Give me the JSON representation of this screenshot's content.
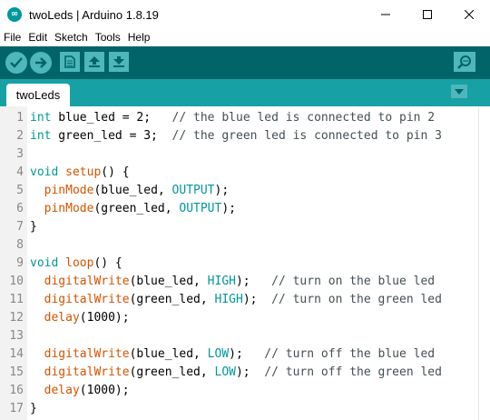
{
  "window": {
    "title": "twoLeds | Arduino 1.8.19",
    "logo_glyph": "∞"
  },
  "menu": [
    "File",
    "Edit",
    "Sketch",
    "Tools",
    "Help"
  ],
  "toolbar": {
    "buttons": [
      "verify-icon",
      "upload-icon",
      "new-icon",
      "open-icon",
      "save-icon",
      "serial-monitor-icon"
    ]
  },
  "tabs": [
    {
      "label": "twoLeds"
    }
  ],
  "editor": {
    "line_numbers": [
      "1",
      "2",
      "3",
      "4",
      "5",
      "6",
      "7",
      "8",
      "9",
      "10",
      "11",
      "12",
      "13",
      "14",
      "15",
      "16",
      "17"
    ],
    "lines": [
      [
        [
          "kw",
          "int"
        ],
        [
          "pl",
          " blue_led = 2;   "
        ],
        [
          "cm",
          "// the blue led is connected to pin 2"
        ]
      ],
      [
        [
          "kw",
          "int"
        ],
        [
          "pl",
          " green_led = 3;  "
        ],
        [
          "cm",
          "// the green led is connected to pin 3"
        ]
      ],
      [],
      [
        [
          "kw",
          "void"
        ],
        [
          "pl",
          " "
        ],
        [
          "fn",
          "setup"
        ],
        [
          "pl",
          "() {"
        ]
      ],
      [
        [
          "pl",
          "  "
        ],
        [
          "fn",
          "pinMode"
        ],
        [
          "pl",
          "(blue_led, "
        ],
        [
          "cst",
          "OUTPUT"
        ],
        [
          "pl",
          ");"
        ]
      ],
      [
        [
          "pl",
          "  "
        ],
        [
          "fn",
          "pinMode"
        ],
        [
          "pl",
          "(green_led, "
        ],
        [
          "cst",
          "OUTPUT"
        ],
        [
          "pl",
          ");"
        ]
      ],
      [
        [
          "pl",
          "}"
        ]
      ],
      [],
      [
        [
          "kw",
          "void"
        ],
        [
          "pl",
          " "
        ],
        [
          "fn",
          "loop"
        ],
        [
          "pl",
          "() {"
        ]
      ],
      [
        [
          "pl",
          "  "
        ],
        [
          "fn",
          "digitalWrite"
        ],
        [
          "pl",
          "(blue_led, "
        ],
        [
          "cst",
          "HIGH"
        ],
        [
          "pl",
          ");   "
        ],
        [
          "cm",
          "// turn on the blue led"
        ]
      ],
      [
        [
          "pl",
          "  "
        ],
        [
          "fn",
          "digitalWrite"
        ],
        [
          "pl",
          "(green_led, "
        ],
        [
          "cst",
          "HIGH"
        ],
        [
          "pl",
          ");  "
        ],
        [
          "cm",
          "// turn on the green led"
        ]
      ],
      [
        [
          "pl",
          "  "
        ],
        [
          "fn",
          "delay"
        ],
        [
          "pl",
          "(1000);"
        ]
      ],
      [],
      [
        [
          "pl",
          "  "
        ],
        [
          "fn",
          "digitalWrite"
        ],
        [
          "pl",
          "(blue_led, "
        ],
        [
          "cst",
          "LOW"
        ],
        [
          "pl",
          ");   "
        ],
        [
          "cm",
          "// turn off the blue led"
        ]
      ],
      [
        [
          "pl",
          "  "
        ],
        [
          "fn",
          "digitalWrite"
        ],
        [
          "pl",
          "(green_led, "
        ],
        [
          "cst",
          "LOW"
        ],
        [
          "pl",
          ");  "
        ],
        [
          "cm",
          "// turn off the green led"
        ]
      ],
      [
        [
          "pl",
          "  "
        ],
        [
          "fn",
          "delay"
        ],
        [
          "pl",
          "(1000);"
        ]
      ],
      [
        [
          "pl",
          "}"
        ]
      ]
    ]
  }
}
